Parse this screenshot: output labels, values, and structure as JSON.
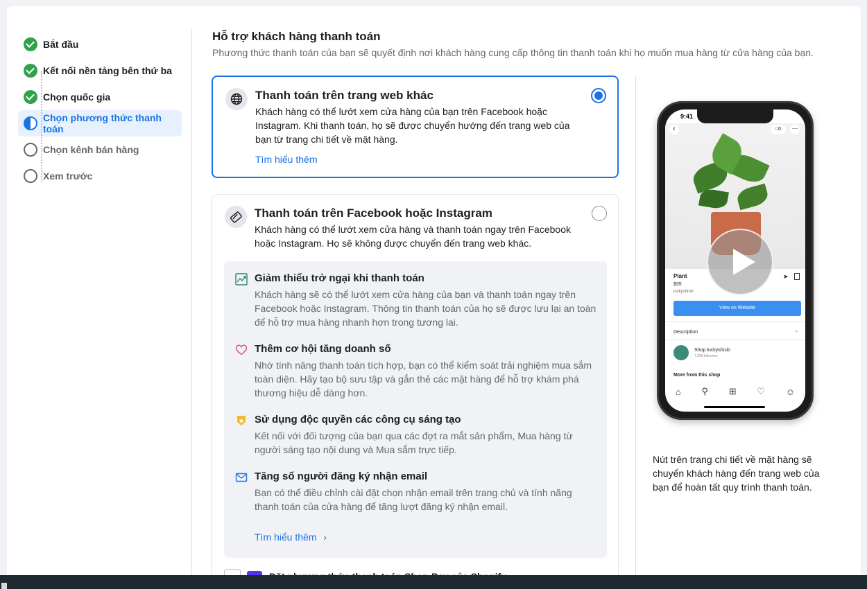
{
  "steps": [
    {
      "label": "Bắt đầu",
      "status": "done"
    },
    {
      "label": "Kết nối nền tảng bên thứ ba",
      "status": "done"
    },
    {
      "label": "Chọn quốc gia",
      "status": "done"
    },
    {
      "label": "Chọn phương thức thanh toán",
      "status": "active"
    },
    {
      "label": "Chọn kênh bán hàng",
      "status": "todo"
    },
    {
      "label": "Xem trước",
      "status": "todo"
    }
  ],
  "header": {
    "title": "Hỗ trợ khách hàng thanh toán",
    "subtitle": "Phương thức thanh toán của bạn sẽ quyết định nơi khách hàng cung cấp thông tin thanh toán khi họ muốn mua hàng từ cửa hàng của bạn."
  },
  "option1": {
    "title": "Thanh toán trên trang web khác",
    "description": "Khách hàng có thể lướt xem cửa hàng của bạn trên Facebook hoặc Instagram. Khi thanh toán, họ sẽ được chuyển hướng đến trang web của bạn từ trang chi tiết về mặt hàng.",
    "link": "Tìm hiểu thêm",
    "selected": true,
    "icon": "globe-icon"
  },
  "option2": {
    "title": "Thanh toán trên Facebook hoặc Instagram",
    "description": "Khách hàng có thể lướt xem cửa hàng và thanh toán ngay trên Facebook hoặc Instagram. Họ sẽ không được chuyển đến trang web khác.",
    "selected": false,
    "icon": "card-icon",
    "benefits": [
      {
        "title": "Giảm thiểu trở ngại khi thanh toán",
        "description": "Khách hàng sẽ có thể lướt xem cửa hàng của bạn và thanh toán ngay trên Facebook hoặc Instagram. Thông tin thanh toán của họ sẽ được lưu lại an toàn để hỗ trợ mua hàng nhanh hơn trong tương lai.",
        "icon": "trend-icon"
      },
      {
        "title": "Thêm cơ hội tăng doanh số",
        "description": "Nhờ tính năng thanh toán tích hợp, bạn có thể kiểm soát trải nghiệm mua sắm toàn diện. Hãy tạo bộ sưu tập và gắn thẻ các mặt hàng để hỗ trợ khám phá thương hiệu dễ dàng hơn.",
        "icon": "heart-icon"
      },
      {
        "title": "Sử dụng độc quyền các công cụ sáng tạo",
        "description": "Kết nối với đối tượng của bạn qua các đợt ra mắt sản phẩm, Mua hàng từ người sáng tạo nội dung và Mua sắm trực tiếp.",
        "icon": "badge-icon"
      },
      {
        "title": "Tăng số người đăng ký nhận email",
        "description": "Bạn có thể điều chỉnh cài đặt chọn nhận email trên trang chủ và tính năng thanh toán của cửa hàng để tăng lượt đăng ký nhận email.",
        "icon": "mail-icon"
      }
    ],
    "link": "Tìm hiểu thêm"
  },
  "option3": {
    "title": "Đặt phương thức thanh toán Shop Pay của Shopify"
  },
  "preview": {
    "time": "9:41",
    "product_name": "Plant",
    "product_price": "$35",
    "shop_handle": "luckyshrub",
    "button": "View on Website",
    "description_label": "Description",
    "shop_name": "Shop luckyshrub",
    "followers": "7,209 followers",
    "more_label": "More from this shop",
    "cart_count": "0",
    "caption": "Nút trên trang chi tiết về mặt hàng sẽ chuyển khách hàng đến trang web của bạn để hoàn tất quy trình thanh toán."
  },
  "colors": {
    "accent": "#1b74e4",
    "success": "#31a24c",
    "text": "#1c1e21",
    "muted": "#65676b"
  }
}
